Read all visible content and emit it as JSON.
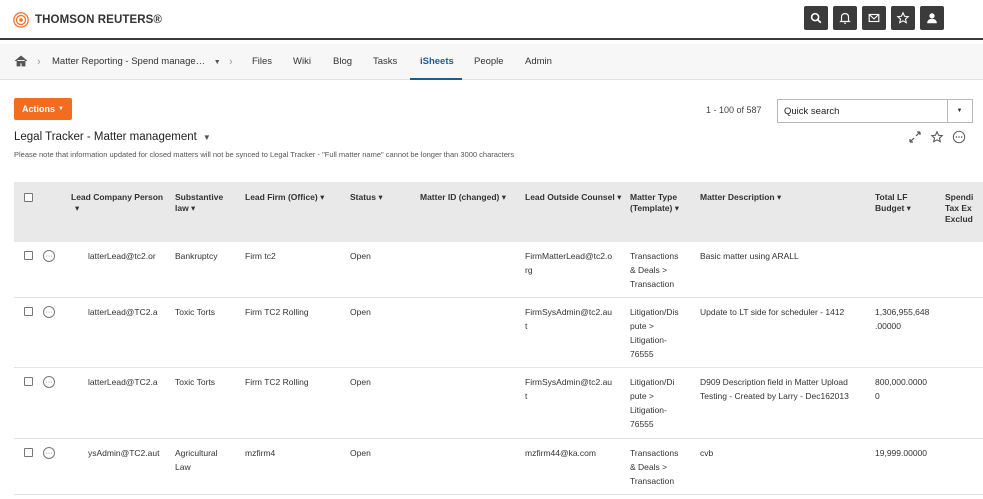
{
  "brand": {
    "name": "THOMSON REUTERS®",
    "accent": "#f36d21"
  },
  "topbar": {
    "icons": [
      "search-icon",
      "bell-icon",
      "mail-icon",
      "star-icon",
      "user-icon"
    ]
  },
  "nav": {
    "home_icon": "home-icon",
    "breadcrumb": "Matter Reporting - Spend manage…",
    "tabs": [
      "Files",
      "Wiki",
      "Blog",
      "Tasks",
      "iSheets",
      "People",
      "Admin"
    ],
    "active_tab": "iSheets"
  },
  "toolbar": {
    "actions_label": "Actions",
    "count_text": "1 - 100 of 587",
    "search_placeholder": "Quick search"
  },
  "sheet": {
    "title": "Legal Tracker - Matter management",
    "notice": "Please note that information updated for closed matters will not be synced to Legal Tracker - \"Full matter name\" cannot be longer than 3000 characters"
  },
  "table": {
    "columns": [
      {
        "line1": "Lead Company Person",
        "line2": "▾"
      },
      {
        "line1": "Substantive",
        "line2": "law ▾"
      },
      {
        "line1": "Lead Firm (Office) ▾",
        "line2": ""
      },
      {
        "line1": "Status ▾",
        "line2": ""
      },
      {
        "line1": "Matter ID (changed) ▾",
        "line2": ""
      },
      {
        "line1": "Lead Outside Counsel ▾",
        "line2": ""
      },
      {
        "line1": "Matter Type",
        "line2": "(Template) ▾"
      },
      {
        "line1": "Matter Description ▾",
        "line2": ""
      },
      {
        "line1": "Total LF",
        "line2": "Budget ▾"
      },
      {
        "line1": "Spendi",
        "line2": "Tax Ex",
        "line3": "Exclud"
      }
    ],
    "rows": [
      {
        "lead_person": "latterLead@tc2.or",
        "law": [
          "Bankruptcy"
        ],
        "firm": "Firm tc2",
        "status": "Open",
        "matter_id": "",
        "counsel": [
          "FirmMatterLead@tc2.o",
          "rg"
        ],
        "type": [
          "Transactions",
          "& Deals >",
          "Transaction"
        ],
        "description": [
          "Basic matter using ARALL"
        ],
        "budget": []
      },
      {
        "lead_person": "latterLead@TC2.a",
        "law": [
          "Toxic Torts"
        ],
        "firm": "Firm TC2 Rolling",
        "status": "Open",
        "matter_id": "",
        "counsel": [
          "FirmSysAdmin@tc2.au",
          "t"
        ],
        "type": [
          "Litigation/Dis",
          "pute >",
          "Litigation-",
          "76555"
        ],
        "description": [
          "Update to LT side for scheduler - 1412"
        ],
        "budget": [
          "1,306,955,648",
          ".00000"
        ]
      },
      {
        "lead_person": "latterLead@TC2.a",
        "law": [
          "Toxic Torts"
        ],
        "firm": "Firm TC2 Rolling",
        "status": "Open",
        "matter_id": "",
        "counsel": [
          "FirmSysAdmin@tc2.au",
          "t"
        ],
        "type": [
          "Litigation/Di",
          "pute >",
          "Litigation-",
          "76555"
        ],
        "description": [
          "D909 Description field in Matter Upload",
          "Testing -  Created by Larry - Dec162013"
        ],
        "budget": [
          "800,000.0000",
          "0"
        ]
      },
      {
        "lead_person": "ysAdmin@TC2.aut",
        "law": [
          "Agricultural",
          "Law"
        ],
        "firm": "mzfirm4",
        "status": "Open",
        "matter_id": "",
        "counsel": [
          "mzfirm44@ka.com"
        ],
        "type": [
          "Transactions",
          "& Deals >",
          "Transaction"
        ],
        "description": [
          "cvb"
        ],
        "budget": [
          "19,999.00000"
        ]
      }
    ]
  }
}
